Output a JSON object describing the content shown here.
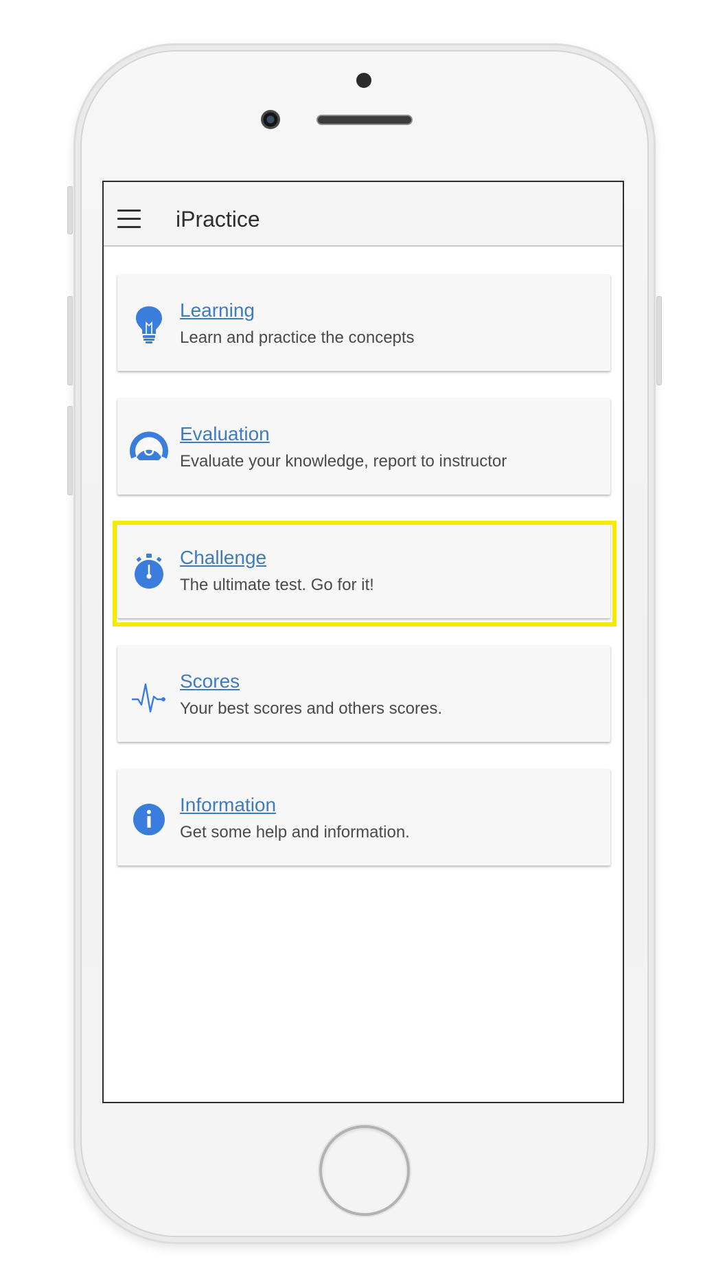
{
  "app": {
    "title": "iPractice"
  },
  "menu": [
    {
      "title": "Learning",
      "description": "Learn and practice the concepts",
      "icon": "lightbulb-icon"
    },
    {
      "title": "Evaluation",
      "description": "Evaluate your knowledge, report to instructor",
      "icon": "speedometer-icon"
    },
    {
      "title": "Challenge",
      "description": "The ultimate test. Go for it!",
      "icon": "stopwatch-icon"
    },
    {
      "title": "Scores",
      "description": "Your best scores and others scores.",
      "icon": "pulse-icon"
    },
    {
      "title": "Information",
      "description": "Get some help and information.",
      "icon": "info-icon"
    }
  ],
  "colors": {
    "accent": "#3f7bc0",
    "icon": "#3b7ddd",
    "highlight": "#f5ea00",
    "appbar": "#f5f5f5"
  }
}
